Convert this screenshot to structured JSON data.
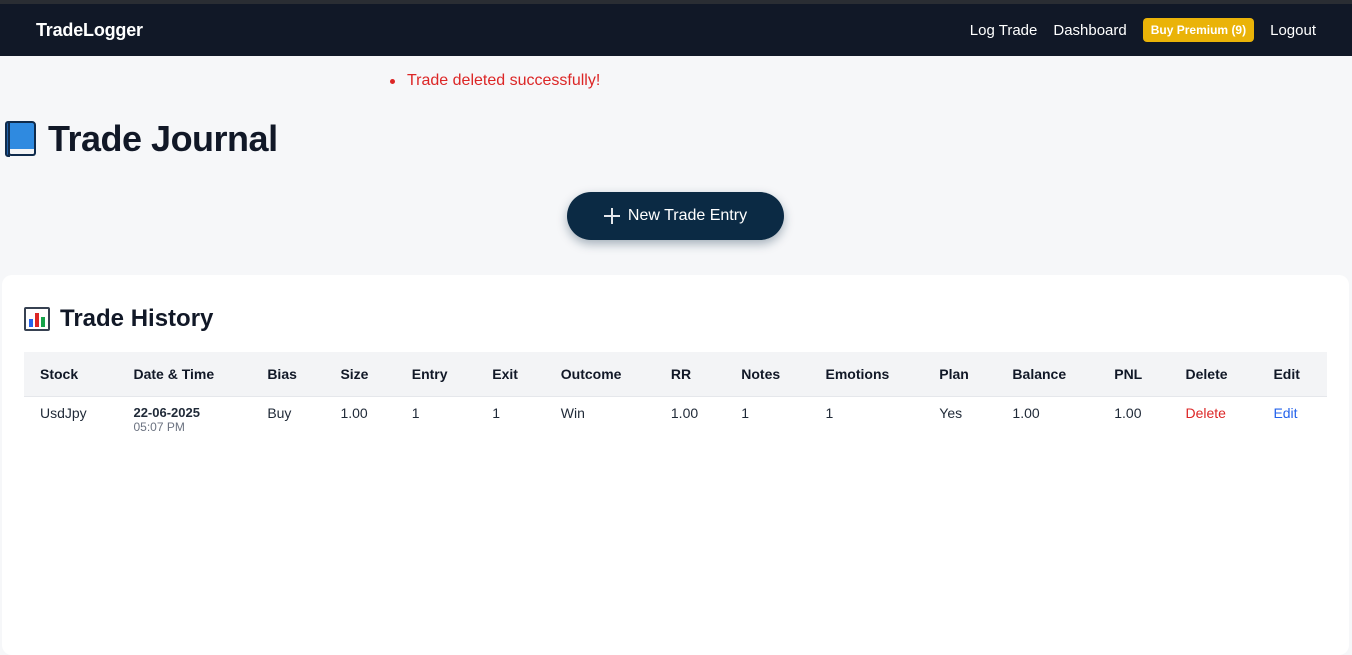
{
  "nav": {
    "brand": "TradeLogger",
    "links": {
      "log_trade": "Log Trade",
      "dashboard": "Dashboard",
      "premium": "Buy Premium (9)",
      "logout": "Logout"
    }
  },
  "flash": {
    "message": "Trade deleted successfully!"
  },
  "page": {
    "title": "Trade Journal",
    "title_icon": "book-icon",
    "new_entry_label": "New Trade Entry"
  },
  "history": {
    "title": "Trade History",
    "title_icon": "bar-chart-icon",
    "columns": [
      "Stock",
      "Date & Time",
      "Bias",
      "Size",
      "Entry",
      "Exit",
      "Outcome",
      "RR",
      "Notes",
      "Emotions",
      "Plan",
      "Balance",
      "PNL",
      "Delete",
      "Edit"
    ],
    "rows": [
      {
        "stock": "UsdJpy",
        "date": "22-06-2025",
        "time": "05:07 PM",
        "bias": "Buy",
        "size": "1.00",
        "entry": "1",
        "exit": "1",
        "outcome": "Win",
        "rr": "1.00",
        "notes": "1",
        "emotions": "1",
        "plan": "Yes",
        "balance": "1.00",
        "pnl": "1.00",
        "delete": "Delete",
        "edit": "Edit"
      }
    ]
  },
  "colors": {
    "navbar": "#111827",
    "premium": "#eab308",
    "primary_button": "#0b2a44",
    "danger": "#dc2626",
    "link": "#2563eb"
  }
}
